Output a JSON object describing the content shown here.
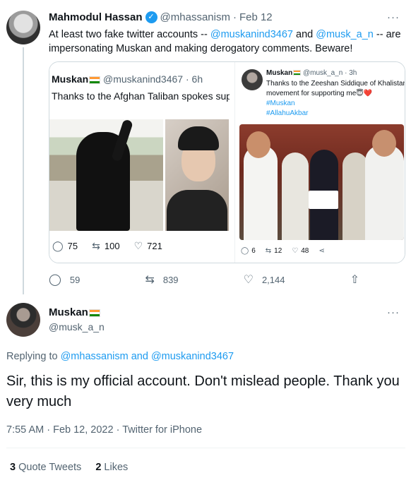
{
  "tweet": {
    "author_name": "Mahmodul Hassan",
    "author_handle": "@mhassanism",
    "date": "Feb 12",
    "more_label": "···",
    "text_before": "At least two fake twitter accounts -- ",
    "mention1": "@muskanind3467",
    "text_mid": " and ",
    "mention2": "@musk_a_n",
    "text_after": " -- are impersonating Muskan and making derogatory comments. Beware!",
    "actions": {
      "replies": "59",
      "retweets": "839",
      "likes": "2,144"
    }
  },
  "screenshot_left": {
    "name": "Muskan",
    "handle": "@muskanind3467",
    "time": "6h",
    "text": "Thanks to the Afghan Taliban spokes supported me❤️😇",
    "replies": "75",
    "retweets": "100",
    "likes": "721"
  },
  "screenshot_right": {
    "name": "Muskan",
    "handle": "@musk_a_n",
    "time": "3h",
    "text": "Thanks to the Zeeshan Siddique of Khalistan movement for supporting me😇❤️",
    "tag1": "#Muskan",
    "tag2": "#AllahuAkbar",
    "replies": "6",
    "retweets": "12",
    "likes": "48"
  },
  "reply": {
    "name": "Muskan",
    "handle": "@musk_a_n",
    "more_label": "···",
    "replying_label": "Replying to ",
    "replying_to1": "@mhassanism",
    "replying_and": " and ",
    "replying_to2": "@muskanind3467",
    "text": "Sir, this is my official account. Don't mislead people. Thank you very much",
    "time": "7:55 AM",
    "date": "Feb 12, 2022",
    "client": "Twitter for iPhone",
    "quote_count": "3",
    "quote_label": "Quote Tweets",
    "like_count": "2",
    "like_label": "Likes"
  }
}
